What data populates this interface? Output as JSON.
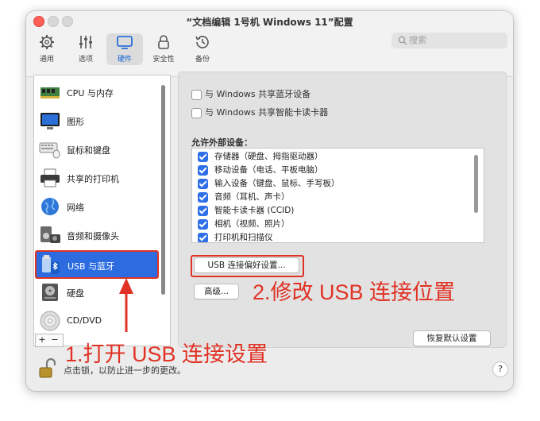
{
  "window": {
    "title": "“文档编辑 1号机 Windows 11”配置"
  },
  "toolbar": {
    "items": [
      {
        "label": "通用",
        "icon": "gear-icon"
      },
      {
        "label": "选项",
        "icon": "sliders-icon"
      },
      {
        "label": "硬件",
        "icon": "monitor-icon",
        "active": true
      },
      {
        "label": "安全性",
        "icon": "lock-icon"
      },
      {
        "label": "备份",
        "icon": "history-icon"
      }
    ],
    "search_placeholder": "搜索"
  },
  "sidebar": {
    "items": [
      {
        "label": "CPU 与内存",
        "icon": "ram-chip-icon"
      },
      {
        "label": "图形",
        "icon": "display-icon"
      },
      {
        "label": "鼠标和键盘",
        "icon": "keyboard-icon"
      },
      {
        "label": "共享的打印机",
        "icon": "printer-icon"
      },
      {
        "label": "网络",
        "icon": "globe-icon"
      },
      {
        "label": "音频和摄像头",
        "icon": "speaker-camera-icon"
      },
      {
        "label": "USB 与蓝牙",
        "icon": "usb-bluetooth-icon",
        "selected": true
      },
      {
        "label": "硬盘",
        "icon": "hard-disk-icon"
      },
      {
        "label": "CD/DVD",
        "icon": "cd-icon"
      }
    ],
    "add_label": "+",
    "remove_label": "−"
  },
  "panel": {
    "share_bluetooth": "与 Windows 共享蓝牙设备",
    "share_smartcard": "与 Windows 共享智能卡读卡器",
    "allow_external_label": "允许外部设备：",
    "devices": [
      "存储器（硬盘、拇指驱动器）",
      "移动设备（电话、平板电脑）",
      "输入设备（键盘、鼠标、手写板）",
      "音频（耳机、声卡）",
      "智能卡读卡器 (CCID)",
      "相机（视频、照片）",
      "打印机和扫描仪"
    ],
    "usb_pref_button": "USB 连接偏好设置...",
    "advanced_button": "高级...",
    "restore_button": "恢复默认设置"
  },
  "footer": {
    "lock_text": "点击锁，以防止进一步的更改。",
    "help_label": "?"
  },
  "annotations": {
    "step1": "1.打开 USB 连接设置",
    "step2": "2.修改 USB 连接位置",
    "color": "#e03325"
  },
  "colors": {
    "accent": "#2c6ce0",
    "highlight": "#e03325"
  }
}
